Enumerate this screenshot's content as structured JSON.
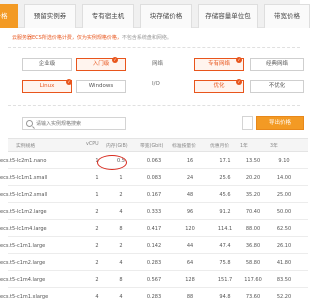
{
  "tabs": [
    {
      "label": "价格",
      "active": true
    },
    {
      "label": "预留实例券",
      "active": false
    },
    {
      "label": "专有宿主机",
      "active": false
    },
    {
      "label": "块存储价格",
      "active": false
    },
    {
      "label": "存储容量单位包",
      "active": false
    },
    {
      "label": "带宽价格",
      "active": false
    }
  ],
  "notice": {
    "part1": "云服务器ECS",
    "part2": "所选价格计费，仅为实例规格价格，",
    "part3": "不包含系统盘和网络。"
  },
  "filters": {
    "category": [
      {
        "label": "企业级",
        "selected": false
      },
      {
        "label": "入门级",
        "selected": true
      }
    ],
    "os": [
      {
        "label": "Linux",
        "selected": true
      },
      {
        "label": "Windows",
        "selected": false
      }
    ],
    "network_label": "网络",
    "network": [
      {
        "label": "专有网络",
        "selected": true
      },
      {
        "label": "经典网络",
        "selected": false
      }
    ],
    "io_label": "I/O",
    "io": [
      {
        "label": "优化",
        "selected": true
      },
      {
        "label": "不优化",
        "selected": false
      }
    ]
  },
  "search": {
    "placeholder": "请输入实例规格搜索"
  },
  "toolbar": {
    "export_label": "导出价格"
  },
  "table": {
    "headers": {
      "name": "实例规格",
      "cpu": "vCPU",
      "mem": "内存(GiB)",
      "bw": "带宽(Gbit)",
      "std": "标准按量价",
      "disc": "优惠月价",
      "m1": "1年",
      "m3": "3年"
    },
    "rows": [
      {
        "name": "ecs.t5-lc2m1.nano",
        "cpu": "1",
        "mem": "0.5",
        "bw": "0.063",
        "std": "16",
        "disc": "17.1",
        "m1": "13.50",
        "m3": "9.10"
      },
      {
        "name": "ecs.t5-lc1m1.small",
        "cpu": "1",
        "mem": "1",
        "bw": "0.083",
        "std": "24",
        "disc": "25.6",
        "m1": "20.20",
        "m3": "14.00"
      },
      {
        "name": "ecs.t5-lc1m2.small",
        "cpu": "1",
        "mem": "2",
        "bw": "0.167",
        "std": "48",
        "disc": "45.6",
        "m1": "35.20",
        "m3": "25.00"
      },
      {
        "name": "ecs.t5-lc1m2.large",
        "cpu": "2",
        "mem": "4",
        "bw": "0.333",
        "std": "96",
        "disc": "91.2",
        "m1": "70.40",
        "m3": "50.00"
      },
      {
        "name": "ecs.t5-lc1m4.large",
        "cpu": "2",
        "mem": "8",
        "bw": "0.417",
        "std": "120",
        "disc": "114.1",
        "m1": "88.00",
        "m3": "62.50"
      },
      {
        "name": "ecs.t5-c1m1.large",
        "cpu": "2",
        "mem": "2",
        "bw": "0.142",
        "std": "44",
        "disc": "47.4",
        "m1": "36.80",
        "m3": "26.10"
      },
      {
        "name": "ecs.t5-c1m2.large",
        "cpu": "2",
        "mem": "4",
        "bw": "0.283",
        "std": "64",
        "disc": "75.8",
        "m1": "58.80",
        "m3": "41.80"
      },
      {
        "name": "ecs.t5-c1m4.large",
        "cpu": "2",
        "mem": "8",
        "bw": "0.567",
        "std": "128",
        "disc": "151.7",
        "m1": "117.60",
        "m3": "83.50"
      },
      {
        "name": "ecs.t5-c1m1.xlarge",
        "cpu": "4",
        "mem": "4",
        "bw": "0.283",
        "std": "88",
        "disc": "94.8",
        "m1": "73.60",
        "m3": "52.20"
      }
    ]
  },
  "colors": {
    "accent": "#f39a24",
    "highlight": "#e8551c",
    "annotation": "#d92b1f"
  }
}
